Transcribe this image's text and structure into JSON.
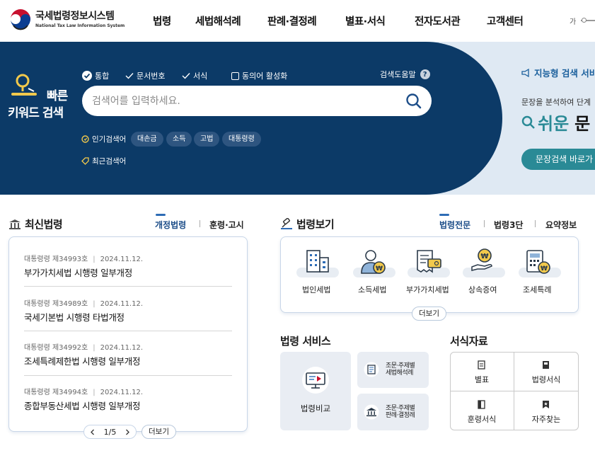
{
  "header": {
    "logo_title": "국세법령정보시스템",
    "logo_subtitle": "National Tax Law Information System",
    "nav": [
      "법령",
      "세법해석례",
      "판례·결정례",
      "별표·서식",
      "전자도서관",
      "고객센터"
    ],
    "font_size_label": "가"
  },
  "hero": {
    "keyword_title_line1": "빠른",
    "keyword_title_line2": "키워드 검색",
    "options": [
      {
        "label": "통합",
        "state": "selected"
      },
      {
        "label": "문서번호",
        "state": "check"
      },
      {
        "label": "서식",
        "state": "check"
      },
      {
        "label": "동의어 활성화",
        "state": "checkbox"
      }
    ],
    "help_label": "검색도움말",
    "help_icon": "?",
    "search_placeholder": "검색어를 입력하세요.",
    "popular_label": "인기검색어",
    "popular_terms": [
      "대손금",
      "소득",
      "고법",
      "대통령령"
    ],
    "recent_label": "최근검색어",
    "smart_title": "지능형 검색 서비",
    "smart_desc": "문장을 분석하여 단계",
    "smart_big_1": "쉬운",
    "smart_big_2": "문",
    "smart_button": "문장검색 바로가"
  },
  "latest_laws": {
    "title": "최신법령",
    "tabs": [
      "개정법령",
      "훈령·고시"
    ],
    "active_tab": "개정법령",
    "items": [
      {
        "meta_no": "대통령령 제34993호",
        "date": "2024.11.12.",
        "title": "부가가치세법 시행령 일부개정"
      },
      {
        "meta_no": "대통령령 제34989호",
        "date": "2024.11.12.",
        "title": "국세기본법 시행령 타법개정"
      },
      {
        "meta_no": "대통령령 제34992호",
        "date": "2024.11.12.",
        "title": "조세특례제한법 시행령 일부개정"
      },
      {
        "meta_no": "대통령령 제34994호",
        "date": "2024.11.12.",
        "title": "종합부동산세법 시행령 일부개정"
      }
    ],
    "pager": "1/5",
    "more": "더보기"
  },
  "law_view": {
    "title": "법령보기",
    "tabs": [
      "법령전문",
      "법령3단",
      "요약정보"
    ],
    "active_tab": "법령전문",
    "items": [
      {
        "label": "법인세법",
        "icon": "building-icon"
      },
      {
        "label": "소득세법",
        "icon": "person-won-icon"
      },
      {
        "label": "부가가치세법",
        "icon": "receipt-card-icon"
      },
      {
        "label": "상속증여",
        "icon": "hand-coin-icon"
      },
      {
        "label": "조세특례",
        "icon": "calculator-icon"
      }
    ],
    "more": "더보기"
  },
  "law_services": {
    "title": "법령 서비스",
    "compare": "법령비교",
    "svc1_line1": "조문·주제별",
    "svc1_line2": "세법해석례",
    "svc2_line1": "조문·주제별",
    "svc2_line2": "판례·결정례"
  },
  "forms": {
    "title": "서식자료",
    "items": [
      "별표",
      "법령서식",
      "훈령서식",
      "자주찾는"
    ]
  }
}
